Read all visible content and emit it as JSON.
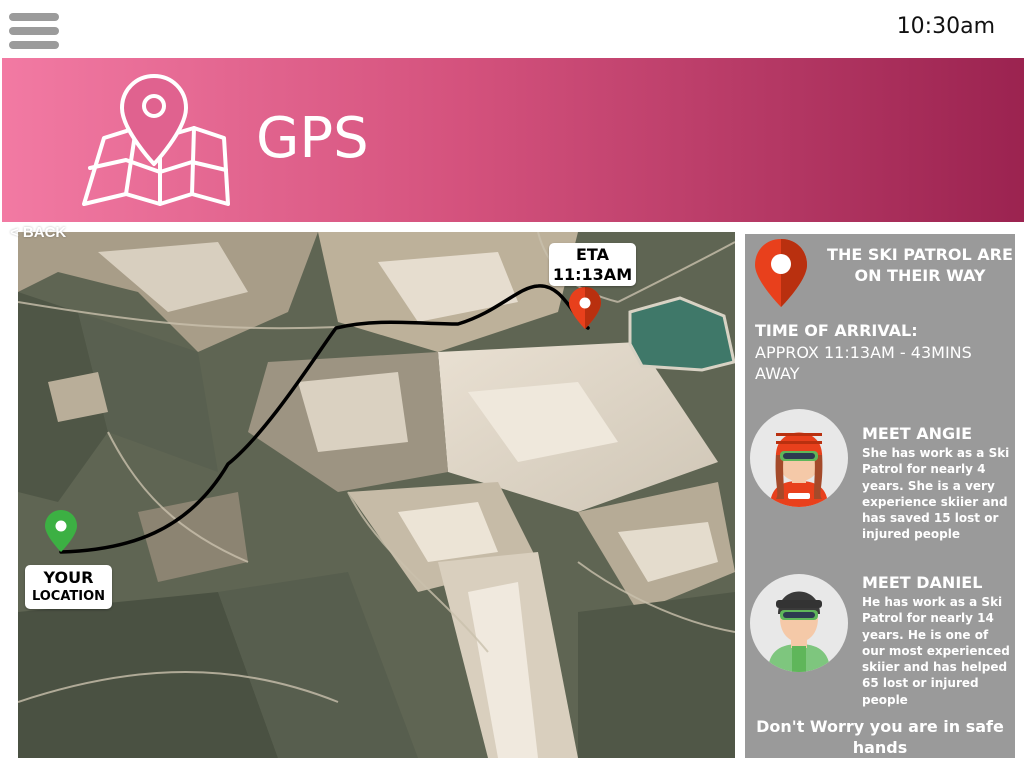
{
  "app": {
    "time": "10:30am",
    "title": "GPS",
    "back_label": "< BACK",
    "accent_color": "#d4527d",
    "icons": {
      "menu": "hamburger-menu-icon",
      "header": "map-pin-icon",
      "destination": "red-map-pin-icon",
      "origin": "green-map-pin-icon"
    }
  },
  "map": {
    "eta_label_line1": "ETA",
    "eta_label_line2": "11:13AM",
    "you_label_line1": "YOUR",
    "you_label_line2": "LOCATION",
    "route_color": "#000000",
    "destination_pin_color": "#e8401c",
    "origin_pin_color": "#3cb043"
  },
  "panel": {
    "patrol_message": "THE SKI PATROL ARE ON THEIR WAY",
    "arrival_heading": "TIME OF ARRIVAL:",
    "arrival_text": "APPROX 11:13AM - 43MINS AWAY",
    "members": [
      {
        "heading": "MEET ANGIE",
        "bio": "She has work as a Ski Patrol for nearly 4 years. She is a very experience skiier and has saved 15 lost or injured people"
      },
      {
        "heading": "MEET DANIEL",
        "bio": "He has work as a Ski Patrol for nearly 14 years. He is one of our most experienced skiier and has helped 65 lost or injured people"
      }
    ],
    "footer_message": "Don't Worry you are in safe hands"
  }
}
